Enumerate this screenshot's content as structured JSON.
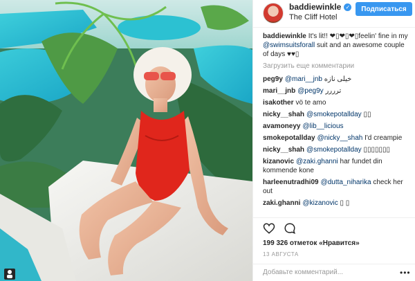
{
  "post": {
    "image_alt_icon": "photo",
    "header": {
      "username": "baddiewinkle",
      "verified_icon": "verified-badge-icon",
      "location": "The Cliff Hotel",
      "follow_label": "Подписаться"
    },
    "caption": {
      "user": "baddiewinkle",
      "text_before": "It's lit!! ❤︎▯❤︎▯❤︎▯feelin' fine in my ",
      "mention": "@swimsuitsforall",
      "text_after": " suit and an awesome couple of days ♥♥▯"
    },
    "load_more_label": "Загрузить еще комментарии",
    "comments": [
      {
        "user": "peg9y",
        "mention": "@mari__jnb",
        "text": " خیلی ناز‌ه"
      },
      {
        "user": "mari__jnb",
        "mention": "@peg9y",
        "text": " ترررر"
      },
      {
        "user": "isakother",
        "mention": "",
        "text": "vö te amo"
      },
      {
        "user": "nicky__shah",
        "mention": "@smokepotallday",
        "text": " ▯▯"
      },
      {
        "user": "avamoneyy",
        "mention": "@lib__licious",
        "text": ""
      },
      {
        "user": "smokepotallday",
        "mention": "@nicky__shah",
        "text": " I'd creampie"
      },
      {
        "user": "nicky__shah",
        "mention": "@smokepotallday",
        "text": " ▯▯▯▯▯▯▯"
      },
      {
        "user": "kizanovic",
        "mention": "@zaki.ghanni",
        "text": " har fundet din kommende kone"
      },
      {
        "user": "harleenutradhi09",
        "mention": "@dutta_niharika",
        "text": " check her out"
      },
      {
        "user": "zaki.ghanni",
        "mention": "@kizanovic",
        "text": " ▯ ▯"
      }
    ],
    "actions": {
      "like_icon": "heart-icon",
      "comment_icon": "comment-icon",
      "likes_text": "199 326 отметок «Нравится»",
      "date": "13 АВГУСТА",
      "add_comment_placeholder": "Добавьте комментарий...",
      "more_icon": "more-options-icon",
      "more_label": "•••"
    }
  }
}
